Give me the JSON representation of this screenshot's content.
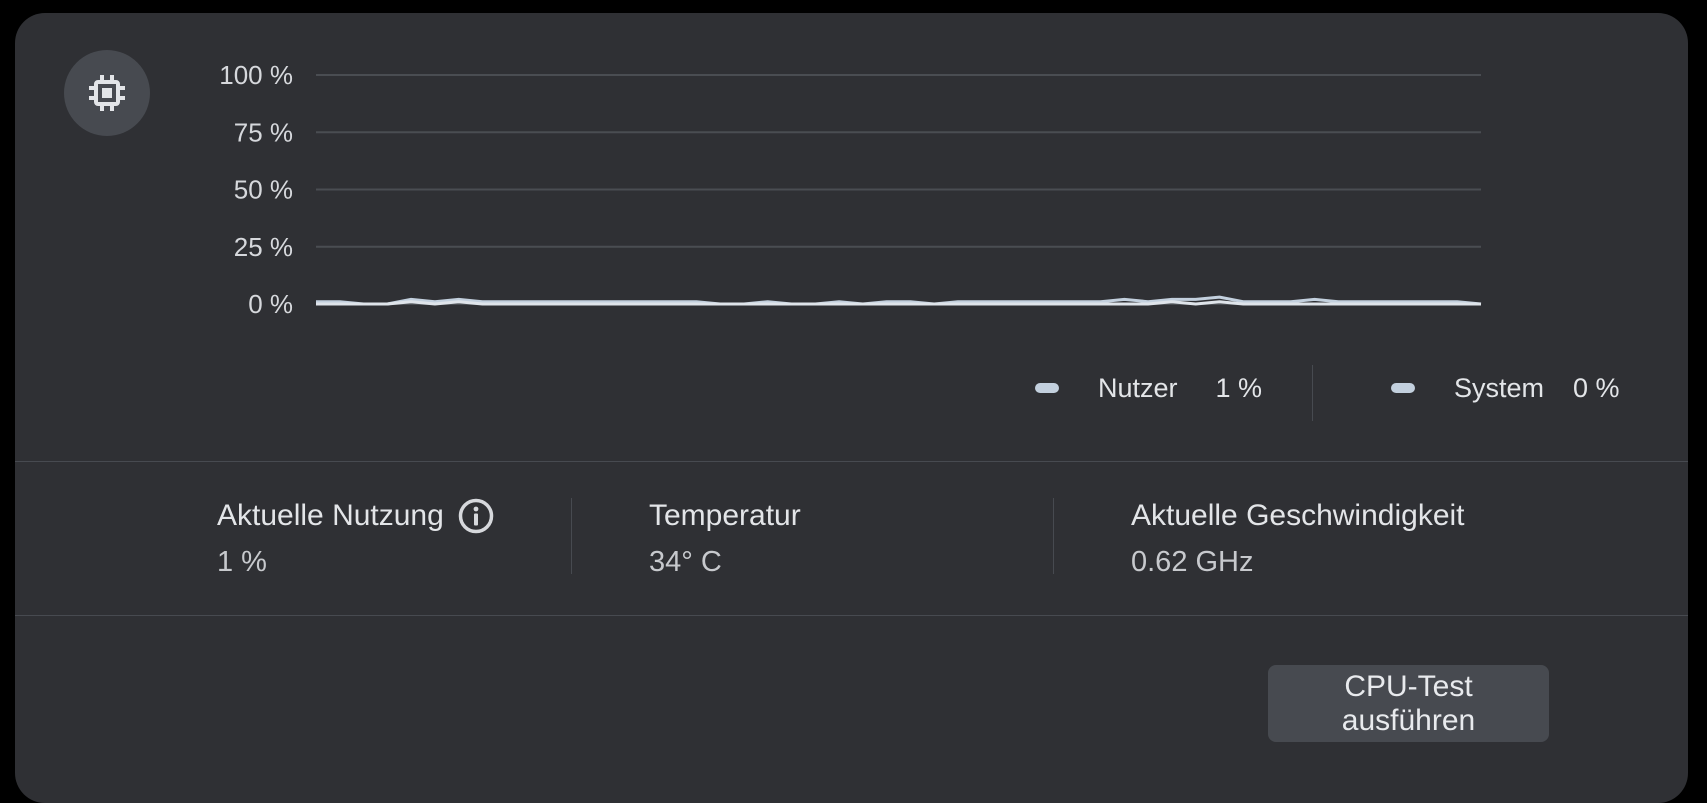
{
  "icon": "cpu-chip-icon",
  "chart_data": {
    "type": "line",
    "y_ticks": [
      "100 %",
      "75 %",
      "50 %",
      "25 %",
      "0 %"
    ],
    "ylim": [
      0,
      100
    ],
    "grid": true,
    "series": [
      {
        "name": "Nutzer",
        "color": "#c3d0de",
        "values": [
          1,
          1,
          0,
          0,
          2,
          1,
          2,
          1,
          1,
          1,
          1,
          1,
          1,
          1,
          1,
          1,
          1,
          0,
          0,
          1,
          0,
          0,
          1,
          0,
          1,
          1,
          0,
          1,
          1,
          1,
          1,
          1,
          1,
          1,
          2,
          1,
          2,
          2,
          3,
          1,
          1,
          1,
          2,
          1,
          1,
          1,
          1,
          1,
          1,
          0
        ]
      },
      {
        "name": "System",
        "color": "#dfe4ea",
        "values": [
          0,
          0,
          0,
          0,
          1,
          0,
          1,
          0,
          0,
          0,
          0,
          0,
          0,
          0,
          0,
          0,
          0,
          0,
          0,
          0,
          0,
          0,
          0,
          0,
          0,
          0,
          0,
          0,
          0,
          0,
          0,
          0,
          0,
          0,
          0,
          0,
          1,
          0,
          1,
          0,
          0,
          0,
          0,
          0,
          0,
          0,
          0,
          0,
          0,
          0
        ]
      }
    ]
  },
  "legend": {
    "user": {
      "label": "Nutzer",
      "value": "1 %"
    },
    "system": {
      "label": "System",
      "value": "0 %"
    }
  },
  "stats": {
    "usage": {
      "label": "Aktuelle Nutzung",
      "value": "1 %",
      "icon": "info-icon"
    },
    "temperature": {
      "label": "Temperatur",
      "value": "34° C"
    },
    "speed": {
      "label": "Aktuelle Geschwindigkeit",
      "value": "0.62 GHz"
    }
  },
  "button": {
    "label": "CPU-Test ausführen"
  }
}
